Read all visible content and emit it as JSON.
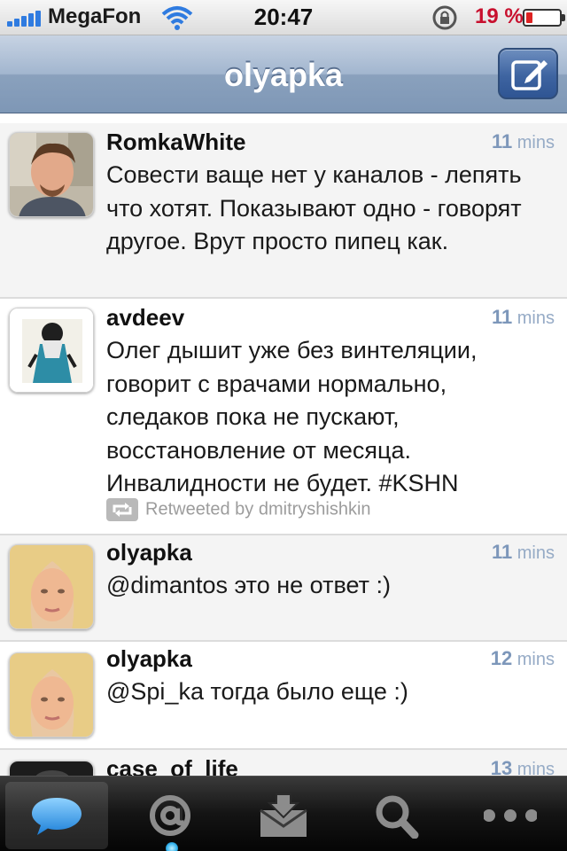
{
  "status_bar": {
    "carrier": "MegaFon",
    "time": "20:47",
    "battery_percent": "19 %",
    "battery_level": 0.19,
    "signal_icon": "signal-bars-icon",
    "wifi_icon": "wifi-icon",
    "lock_icon": "rotation-lock-icon"
  },
  "nav": {
    "title": "olyapka",
    "compose_icon": "compose-icon"
  },
  "tweets": [
    {
      "name": "RomkaWhite",
      "time_num": "11",
      "time_unit": " mins",
      "text": "Совести ваще нет у каналов - лепять что хотят. Показывают одно - говорят другое. Врут просто пипец как."
    },
    {
      "name": "avdeev",
      "time_num": "11",
      "time_unit": " mins",
      "text": "Олег дышит уже без винтеляции, говорит с врачами нормально, следаков пока не пускают, восстановление от месяца. Инвалидности не будет. #KSHN",
      "retweet": "Retweeted by dmitryshishkin"
    },
    {
      "name": "olyapka",
      "time_num": "11",
      "time_unit": " mins",
      "text": "@dimantos это не ответ :)"
    },
    {
      "name": "olyapka",
      "time_num": "12",
      "time_unit": " mins",
      "text": "@Spi_ka тогда было еще :)"
    },
    {
      "name": "case_of_life",
      "time_num": "13",
      "time_unit": " mins"
    }
  ],
  "tab_bar": {
    "tabs": [
      "timeline-icon",
      "mentions-icon",
      "messages-icon",
      "search-icon",
      "more-icon"
    ],
    "active_index": 0
  },
  "colors": {
    "nav_blue": "#8aa1bd",
    "time_blue": "#96abc6",
    "battery_red": "#c8102e"
  }
}
